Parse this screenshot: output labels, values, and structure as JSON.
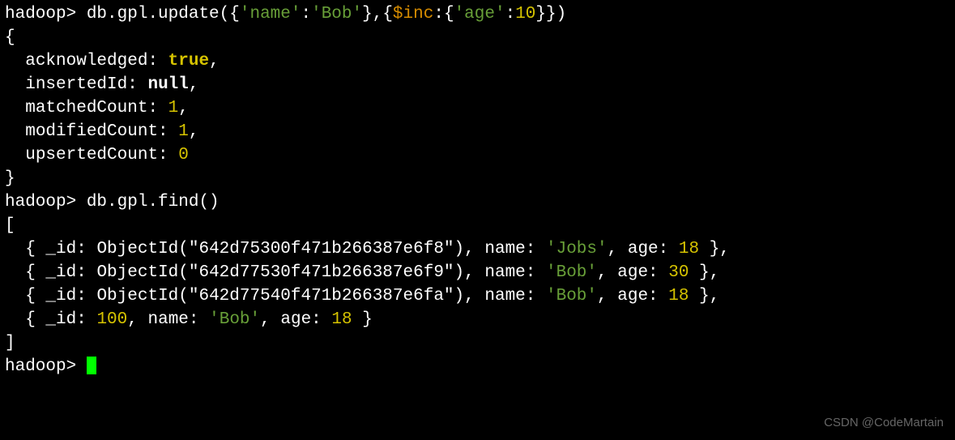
{
  "prompt": "hadoop>",
  "cmd1": {
    "pre": "db.gpl.update({",
    "q1a": "'name'",
    "colon1": ":",
    "q1b": "'Bob'",
    "mid": "},{",
    "inc": "$inc",
    "colon2": ":{",
    "q2a": "'age'",
    "colon3": ":",
    "num": "10",
    "end": "}})"
  },
  "result": {
    "open": "{",
    "ack_k": "acknowledged",
    "ack_v": "true",
    "ins_k": "insertedId",
    "ins_v": "null",
    "match_k": "matchedCount",
    "match_v": "1",
    "mod_k": "modifiedCount",
    "mod_v": "1",
    "ups_k": "upsertedCount",
    "ups_v": "0",
    "close": "}"
  },
  "cmd2": "db.gpl.find()",
  "find": {
    "open": "[",
    "rows": [
      {
        "id_label": "_id",
        "oid": "ObjectId(\"642d75300f471b266387e6f8\")",
        "name_k": "name",
        "name_v": "'Jobs'",
        "age_k": "age",
        "age_v": "18"
      },
      {
        "id_label": "_id",
        "oid": "ObjectId(\"642d77530f471b266387e6f9\")",
        "name_k": "name",
        "name_v": "'Bob'",
        "age_k": "age",
        "age_v": "30"
      },
      {
        "id_label": "_id",
        "oid": "ObjectId(\"642d77540f471b266387e6fa\")",
        "name_k": "name",
        "name_v": "'Bob'",
        "age_k": "age",
        "age_v": "18"
      },
      {
        "id_label": "_id",
        "oid_num": "100",
        "name_k": "name",
        "name_v": "'Bob'",
        "age_k": "age",
        "age_v": "18"
      }
    ],
    "close": "]"
  },
  "watermark": "CSDN @CodeMartain"
}
